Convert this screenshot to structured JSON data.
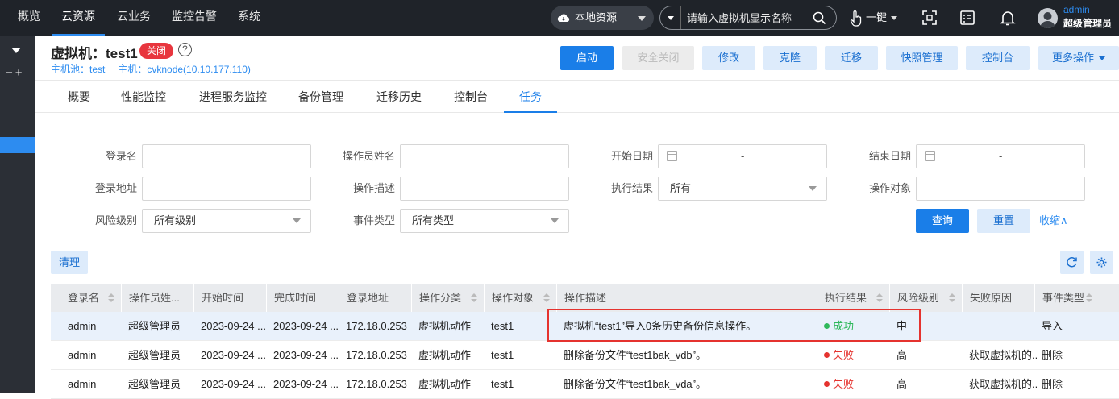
{
  "topnav": {
    "items": [
      {
        "label": "概览"
      },
      {
        "label": "云资源"
      },
      {
        "label": "云业务"
      },
      {
        "label": "监控告警"
      },
      {
        "label": "系统"
      }
    ],
    "active": 1
  },
  "resource_select": {
    "value": "本地资源"
  },
  "search": {
    "placeholder": "请输入虚拟机显示名称"
  },
  "onekey": {
    "label": "一键"
  },
  "user": {
    "name": "admin",
    "role": "超级管理员"
  },
  "sidebar": {
    "pm": "−+"
  },
  "header": {
    "title": "虚拟机：test1",
    "status": "关闭",
    "host_pool": "主机池：test",
    "host": "主机：cvknode(10.10.177.110)"
  },
  "actions": {
    "start": "启动",
    "safe_shutdown": "安全关闭",
    "modify": "修改",
    "clone": "克隆",
    "migrate": "迁移",
    "snapshot": "快照管理",
    "console": "控制台",
    "more": "更多操作"
  },
  "tabs": [
    {
      "label": "概要"
    },
    {
      "label": "性能监控"
    },
    {
      "label": "进程服务监控"
    },
    {
      "label": "备份管理"
    },
    {
      "label": "迁移历史"
    },
    {
      "label": "控制台"
    },
    {
      "label": "任务"
    }
  ],
  "filters": {
    "login_name": {
      "label": "登录名",
      "value": ""
    },
    "operator_name": {
      "label": "操作员姓名",
      "value": ""
    },
    "start_date": {
      "label": "开始日期",
      "sep": "-"
    },
    "end_date": {
      "label": "结束日期",
      "sep": "-"
    },
    "login_addr": {
      "label": "登录地址",
      "value": ""
    },
    "op_desc": {
      "label": "操作描述",
      "value": ""
    },
    "exec_result": {
      "label": "执行结果",
      "value": "所有"
    },
    "op_target": {
      "label": "操作对象",
      "value": ""
    },
    "risk_level": {
      "label": "风险级别",
      "value": "所有级别"
    },
    "event_type": {
      "label": "事件类型",
      "value": "所有类型"
    },
    "query": "查询",
    "reset": "重置",
    "collapse": "收缩∧"
  },
  "toolbar": {
    "clear": "清理"
  },
  "table": {
    "columns": [
      "登录名",
      "操作员姓...",
      "开始时间",
      "完成时间",
      "登录地址",
      "操作分类",
      "操作对象",
      "操作描述",
      "执行结果",
      "风险级别",
      "失败原因",
      "事件类型"
    ],
    "rows": [
      {
        "login": "admin",
        "operator": "超级管理员",
        "start": "2023-09-24 ...",
        "end": "2023-09-24 ...",
        "addr": "172.18.0.253",
        "category": "虚拟机动作",
        "target": "test1",
        "desc": "虚拟机“test1”导入0条历史备份信息操作。",
        "result": "成功",
        "risk": "中",
        "reason": "",
        "event": "导入"
      },
      {
        "login": "admin",
        "operator": "超级管理员",
        "start": "2023-09-24 ...",
        "end": "2023-09-24 ...",
        "addr": "172.18.0.253",
        "category": "虚拟机动作",
        "target": "test1",
        "desc": "删除备份文件“test1bak_vdb”。",
        "result": "失败",
        "risk": "高",
        "reason": "获取虚拟机的...",
        "event": "删除"
      },
      {
        "login": "admin",
        "operator": "超级管理员",
        "start": "2023-09-24 ...",
        "end": "2023-09-24 ...",
        "addr": "172.18.0.253",
        "category": "虚拟机动作",
        "target": "test1",
        "desc": "删除备份文件“test1bak_vda”。",
        "result": "失败",
        "risk": "高",
        "reason": "获取虚拟机的...",
        "event": "删除"
      }
    ]
  },
  "colors": {
    "accent": "#1a7ee8",
    "success": "#2fb85b",
    "fail": "#e5332f",
    "highlight": "#e5332f"
  }
}
